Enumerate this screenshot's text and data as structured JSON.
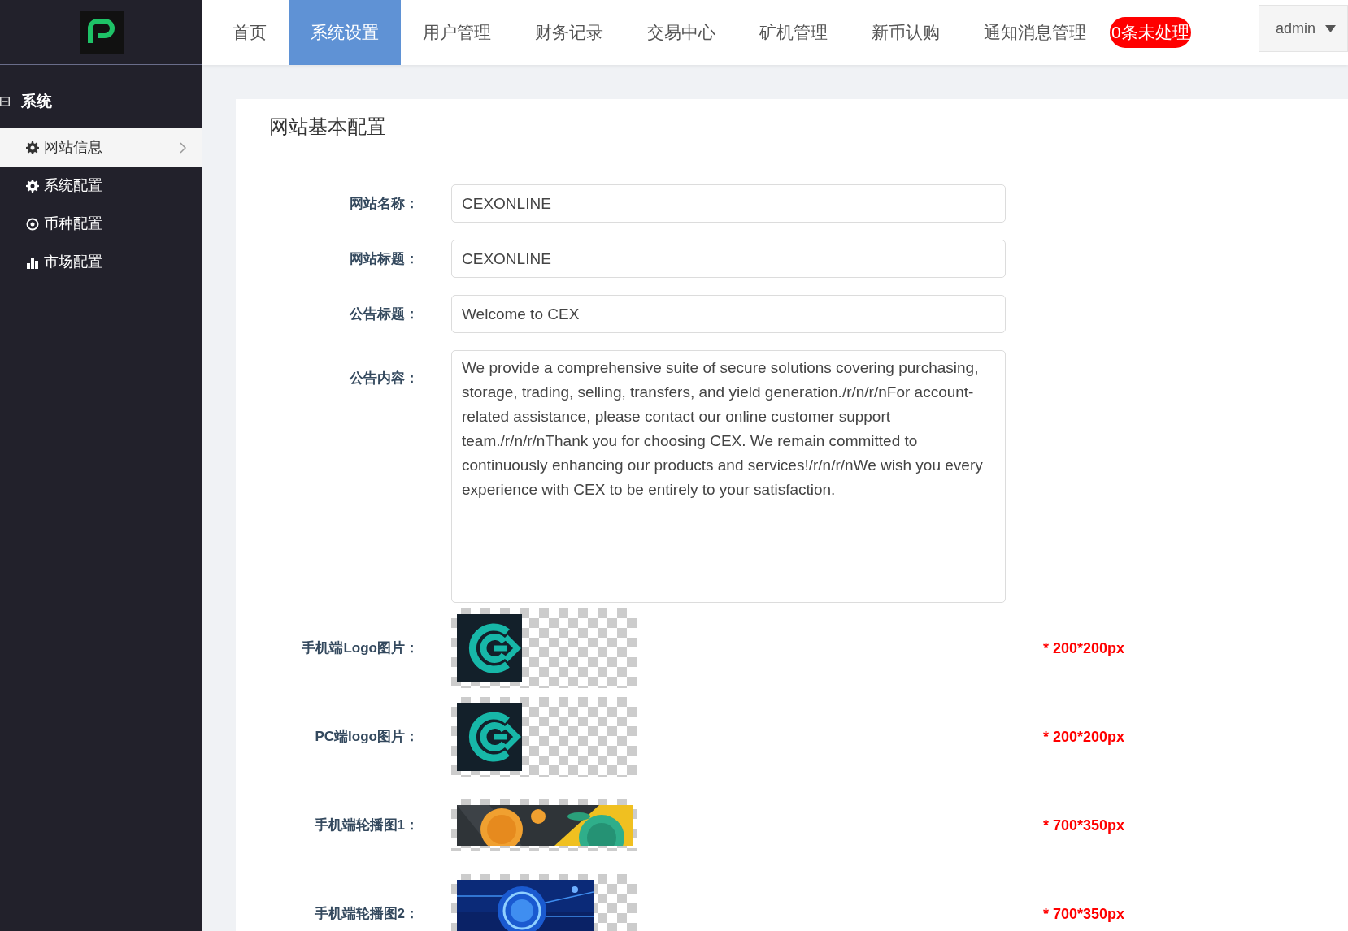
{
  "nav": {
    "items": [
      {
        "label": "首页",
        "selected": false
      },
      {
        "label": "系统设置",
        "selected": true
      },
      {
        "label": "用户管理",
        "selected": false
      },
      {
        "label": "财务记录",
        "selected": false
      },
      {
        "label": "交易中心",
        "selected": false
      },
      {
        "label": "矿机管理",
        "selected": false
      },
      {
        "label": "新币认购",
        "selected": false
      },
      {
        "label": "通知消息管理",
        "selected": false
      }
    ],
    "badge": "0条未处理",
    "user": "admin"
  },
  "sidebar": {
    "group": {
      "title": "系统",
      "expanded": true
    },
    "items": [
      {
        "label": "网站信息",
        "kind": "gear",
        "selected": true
      },
      {
        "label": "系统配置",
        "kind": "gear",
        "selected": false
      },
      {
        "label": "币种配置",
        "kind": "target",
        "selected": false
      },
      {
        "label": "市场配置",
        "kind": "bars",
        "selected": false
      }
    ]
  },
  "card": {
    "title": "网站基本配置",
    "fields": [
      {
        "kind": "input",
        "label": "网站名称：",
        "value": "CEXONLINE"
      },
      {
        "kind": "input",
        "label": "网站标题：",
        "value": "CEXONLINE"
      },
      {
        "kind": "input",
        "label": "公告标题：",
        "value": "Welcome to CEX"
      },
      {
        "kind": "textarea",
        "label": "公告内容：",
        "value": "We provide a comprehensive suite of secure solutions covering purchasing, storage, trading, selling, transfers, and yield generation./r/n/r/nFor account-related assistance, please contact our online customer support team./r/n/r/nThank you for choosing CEX. We remain committed to continuously enhancing our products and services!/r/n/r/nWe wish you every experience with CEX to be entirely to your satisfaction."
      },
      {
        "kind": "logo",
        "label": "手机端Logo图片：",
        "hint": "* 200*200px"
      },
      {
        "kind": "logo",
        "label": "PC端logo图片：",
        "hint": "* 200*200px"
      },
      {
        "kind": "coins",
        "label": "手机端轮播图1：",
        "hint": "* 700*350px"
      },
      {
        "kind": "tech",
        "label": "手机端轮播图2：",
        "hint": "* 700*350px"
      }
    ]
  }
}
